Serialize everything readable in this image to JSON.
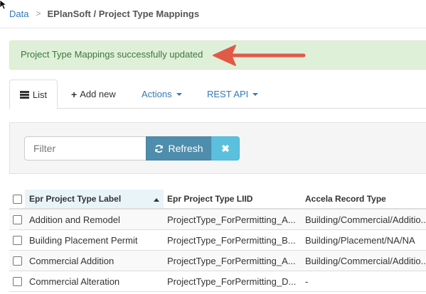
{
  "breadcrumb": {
    "root": "Data",
    "separator": ">",
    "current": "EPlanSoft / Project Type Mappings"
  },
  "alert": {
    "message": "Project Type Mappings successfully updated"
  },
  "tabs": {
    "list": "List",
    "add_new": "Add new",
    "actions": "Actions",
    "rest_api": "REST API"
  },
  "filter": {
    "placeholder": "Filter",
    "refresh_label": "Refresh",
    "clear_label": "✖"
  },
  "table": {
    "columns": [
      "Epr Project Type Label",
      "Epr Project Type LIID",
      "Accela Record Type"
    ],
    "rows": [
      [
        "Addition and Remodel",
        "ProjectType_ForPermitting_A...",
        "Building/Commercial/Additio..."
      ],
      [
        "Building Placement Permit",
        "ProjectType_ForPermitting_B...",
        "Building/Placement/NA/NA"
      ],
      [
        "Commercial Addition",
        "ProjectType_ForPermitting_A...",
        "Building/Commercial/Additio..."
      ],
      [
        "Commercial Alteration",
        "ProjectType_ForPermitting_D...",
        "-"
      ]
    ]
  },
  "colors": {
    "link": "#337ab7",
    "alert_bg": "#dff0d8",
    "alert_text": "#3c763d",
    "arrow": "#e05a47",
    "refresh_bg": "#4f8dac",
    "clear_bg": "#5bc0de"
  }
}
